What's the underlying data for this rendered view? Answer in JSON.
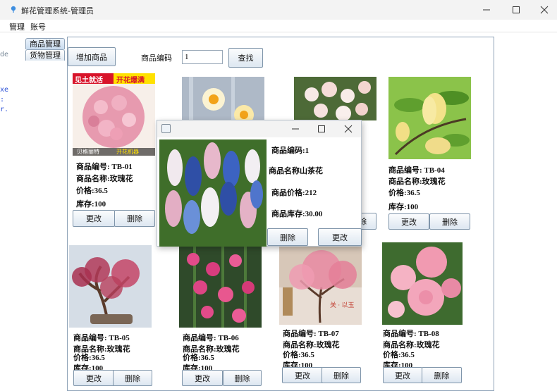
{
  "window": {
    "title": "鲜花管理系统-管理员",
    "minimize_symbol": "—",
    "maximize_symbol": "☐",
    "close_symbol": "✕"
  },
  "menu": {
    "items": [
      "管理",
      "账号"
    ]
  },
  "edge_fragments": [
    "de",
    "xe",
    ":",
    "r."
  ],
  "tabs": [
    {
      "label": "商品管理",
      "active": true
    },
    {
      "label": "货物管理",
      "active": false
    }
  ],
  "toolbar": {
    "add_label": "增加商品",
    "search_label": "商品编码",
    "search_value": "1",
    "find_label": "查找"
  },
  "products": [
    {
      "id": "商品编号: TB-01",
      "name": "商品名称:玫瑰花",
      "price": "价格:36.5",
      "stock": "库存:100",
      "edit": "更改",
      "delete": "删除",
      "banner_left": "见土就活",
      "banner_right": "开花爆满",
      "footer_left": "贝格丽特",
      "footer_right": "开花机器"
    },
    {
      "id": "商品编号: TB-04",
      "name": "商品名称:玫瑰花",
      "price": "价格:36.5",
      "stock": "库存:100",
      "edit": "更改",
      "delete": "删除"
    },
    {
      "id": "商品编号: TB-05",
      "name": "商品名称:玫瑰花",
      "price": "价格:36.5",
      "stock": "库存:100",
      "edit": "更改",
      "delete": "删除"
    },
    {
      "id": "商品编号: TB-06",
      "name": "商品名称:玫瑰花",
      "price": "价格:36.5",
      "stock": "库存:100",
      "edit": "更改",
      "delete": "删除"
    },
    {
      "id": "商品编号: TB-07",
      "name": "商品名称:玫瑰花",
      "price": "价格:36.5",
      "stock": "库存:100",
      "edit": "更改",
      "delete": "删除",
      "watermark": "关 · 以玉"
    },
    {
      "id": "商品编号: TB-08",
      "name": "商品名称:玫瑰花",
      "price": "价格:36.5",
      "stock": "库存:100",
      "edit": "更改",
      "delete": "删除"
    }
  ],
  "hidden_fragments": {
    "delete_partial": "除"
  },
  "dialog": {
    "title_symbols": {
      "minimize": "—",
      "maximize": "☐",
      "close": "✕"
    },
    "code": "商品编码:1",
    "name": "商品名称山茶花",
    "price": "商品价格:212",
    "stock": "商品库存:30.00",
    "delete_label": "删除",
    "edit_label": "更改"
  },
  "colors": {
    "panel_border": "#8fa3b8",
    "button_top": "#fbfcfd",
    "button_bottom": "#dde7f1",
    "title_bg": "#f3f3f3"
  }
}
